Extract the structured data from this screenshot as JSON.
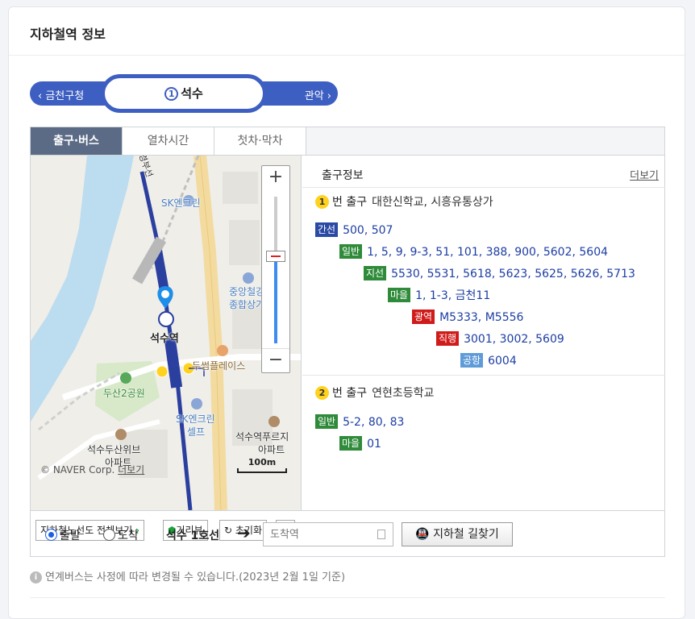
{
  "card": {
    "title": "지하철역 정보"
  },
  "station_nav": {
    "prev_label": "‹ 금천구청",
    "next_label": "관악 ›",
    "line_number": "1",
    "current_station": "석수"
  },
  "tabs": [
    {
      "label": "출구·버스",
      "active": true
    },
    {
      "label": "열차시간",
      "active": false
    },
    {
      "label": "첫차·막차",
      "active": false
    }
  ],
  "map": {
    "labels": {
      "sk1": "SK엔크린",
      "sk2_line1": "SK엔크린",
      "sk2_line2": "셀프",
      "bldg_line1": "중앙철강",
      "bldg_line2": "종합상가",
      "station": "석수역",
      "dusseum": "두썸플레이스",
      "park": "두산2공원",
      "apt1_line1": "석수두산위브",
      "apt1_line2": "아파트",
      "apt2_line1": "석수역푸르지",
      "apt2_line2": "아파트",
      "road": "경부선",
      "pin_number": "1"
    },
    "zoom_in": "+",
    "zoom_out": "−",
    "scale": "100m",
    "copyright": "© NAVER Corp.",
    "copyright_link": "더보기",
    "toolbar": {
      "subway_map_label": "지하철노선도 전체보기",
      "street_view_label": "거리뷰",
      "reset_label": "초기화"
    }
  },
  "exit_info": {
    "header": "출구정보",
    "more_link": "더보기",
    "exits": [
      {
        "number": "1",
        "label": "번 출구",
        "destinations": "대한신학교, 시흥유통상가",
        "buses": [
          {
            "type": "간선",
            "color": "blue",
            "routes": "500, 507"
          },
          {
            "type": "일반",
            "color": "green",
            "routes": "1, 5, 9, 9-3, 51, 101, 388, 900, 5602, 5604"
          },
          {
            "type": "지선",
            "color": "green",
            "routes": "5530, 5531, 5618, 5623, 5625, 5626, 5713"
          },
          {
            "type": "마을",
            "color": "green",
            "routes": "1, 1-3, 금천11"
          },
          {
            "type": "광역",
            "color": "red",
            "routes": "M5333, M5556"
          },
          {
            "type": "직행",
            "color": "red",
            "routes": "3001, 3002, 5609"
          },
          {
            "type": "공항",
            "color": "sky",
            "routes": "6004"
          }
        ]
      },
      {
        "number": "2",
        "label": "번 출구",
        "destinations": "연현초등학교",
        "buses": [
          {
            "type": "일반",
            "color": "green",
            "routes": "5-2, 80, 83"
          },
          {
            "type": "마을",
            "color": "green",
            "routes": "01"
          }
        ]
      }
    ]
  },
  "route": {
    "depart_label": "출발",
    "arrive_label": "도착",
    "station_line": "석수 1호선",
    "arrow": "➔",
    "input_placeholder": "도착역",
    "search_button": "지하철 길찾기"
  },
  "notice": "연계버스는 사정에 따라 변경될 수 있습니다.(2023년 2월 1일 기준)",
  "colors": {
    "line1": "#3e5fc2",
    "exit_badge": "#ffd21f",
    "bus_blue": "#2b4aa3",
    "bus_green": "#2f8b3a",
    "bus_red": "#d01b1b",
    "bus_sky": "#5e9bd8",
    "active_tab": "#5b6b86"
  }
}
